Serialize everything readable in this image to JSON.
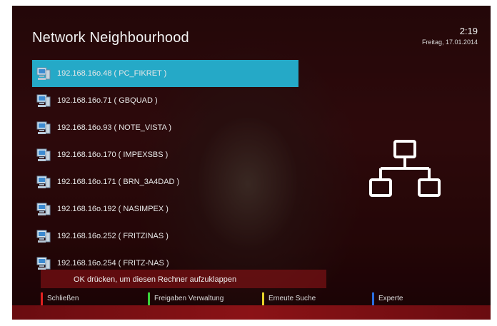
{
  "header": {
    "title": "Network Neighbourhood",
    "time": "2:19",
    "date": "Freitag, 17.01.2014"
  },
  "hosts": [
    {
      "label": "192.168.16o.48 ( PC_FIKRET )",
      "selected": true
    },
    {
      "label": "192.168.16o.71 ( GBQUAD )",
      "selected": false
    },
    {
      "label": "192.168.16o.93 ( NOTE_VISTA )",
      "selected": false
    },
    {
      "label": "192.168.16o.170 ( IMPEXSBS )",
      "selected": false
    },
    {
      "label": "192.168.16o.171 ( BRN_3A4DAD )",
      "selected": false
    },
    {
      "label": "192.168.16o.192 ( NASIMPEX )",
      "selected": false
    },
    {
      "label": "192.168.16o.252 ( FRITZINAS )",
      "selected": false
    },
    {
      "label": "192.168.16o.254 ( FRITZ-NAS )",
      "selected": false
    }
  ],
  "hint": "OK drücken, um diesen Rechner aufzuklappen",
  "footer": {
    "red": "Schließen",
    "green": "Freigaben Verwaltung",
    "yellow": "Erneute Suche",
    "blue": "Experte"
  },
  "colors": {
    "selection": "#25a9c7",
    "red": "#e02020",
    "green": "#3ad13a",
    "yellow": "#e8d22a",
    "blue": "#2a6fe0"
  },
  "icons": {
    "host": "computer-icon",
    "network": "network-topology-icon"
  }
}
